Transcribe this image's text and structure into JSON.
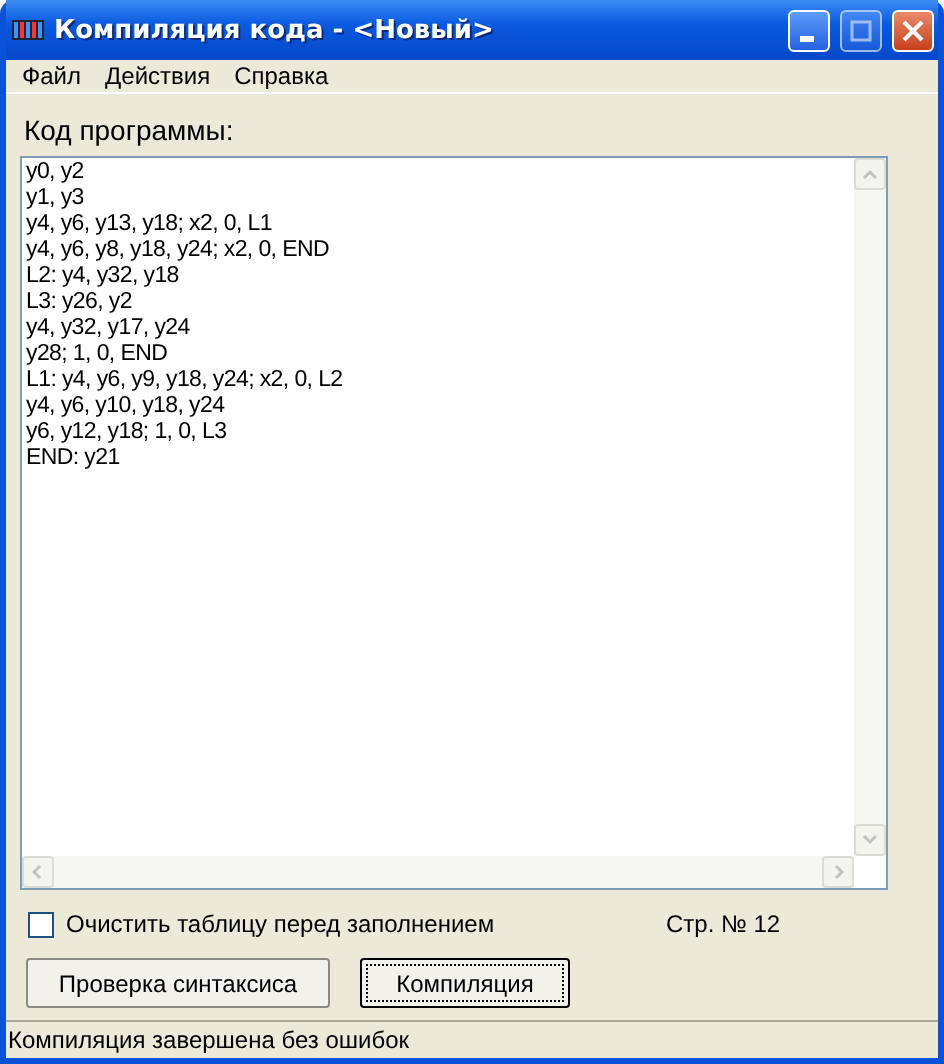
{
  "window": {
    "title": "Компиляция кода - <Новый>"
  },
  "menu": [
    "Файл",
    "Действия",
    "Справка"
  ],
  "editor": {
    "label": "Код программы:",
    "lines": [
      "y0, y2",
      "y1, y3",
      "y4, y6, y13, y18; x2, 0, L1",
      "y4, y6, y8, y18, y24; x2, 0, END",
      "L2: y4, y32, y18",
      "L3: y26, y2",
      "y4, y32, y17, y24",
      "y28; 1, 0, END",
      "L1: y4, y6, y9, y18, y24; x2, 0, L2",
      "y4, y6, y10, y18, y24",
      "y6, y12, y18; 1, 0, L3",
      "END: y21"
    ]
  },
  "clear_table": {
    "label": "Очистить таблицу перед заполнением",
    "checked": false
  },
  "line_count": "Стр. № 12",
  "buttons": [
    {
      "label": "Проверка синтаксиса",
      "focused": false
    },
    {
      "label": "Компиляция",
      "focused": true
    }
  ],
  "status_bar": "Компиляция завершена без ошибок"
}
